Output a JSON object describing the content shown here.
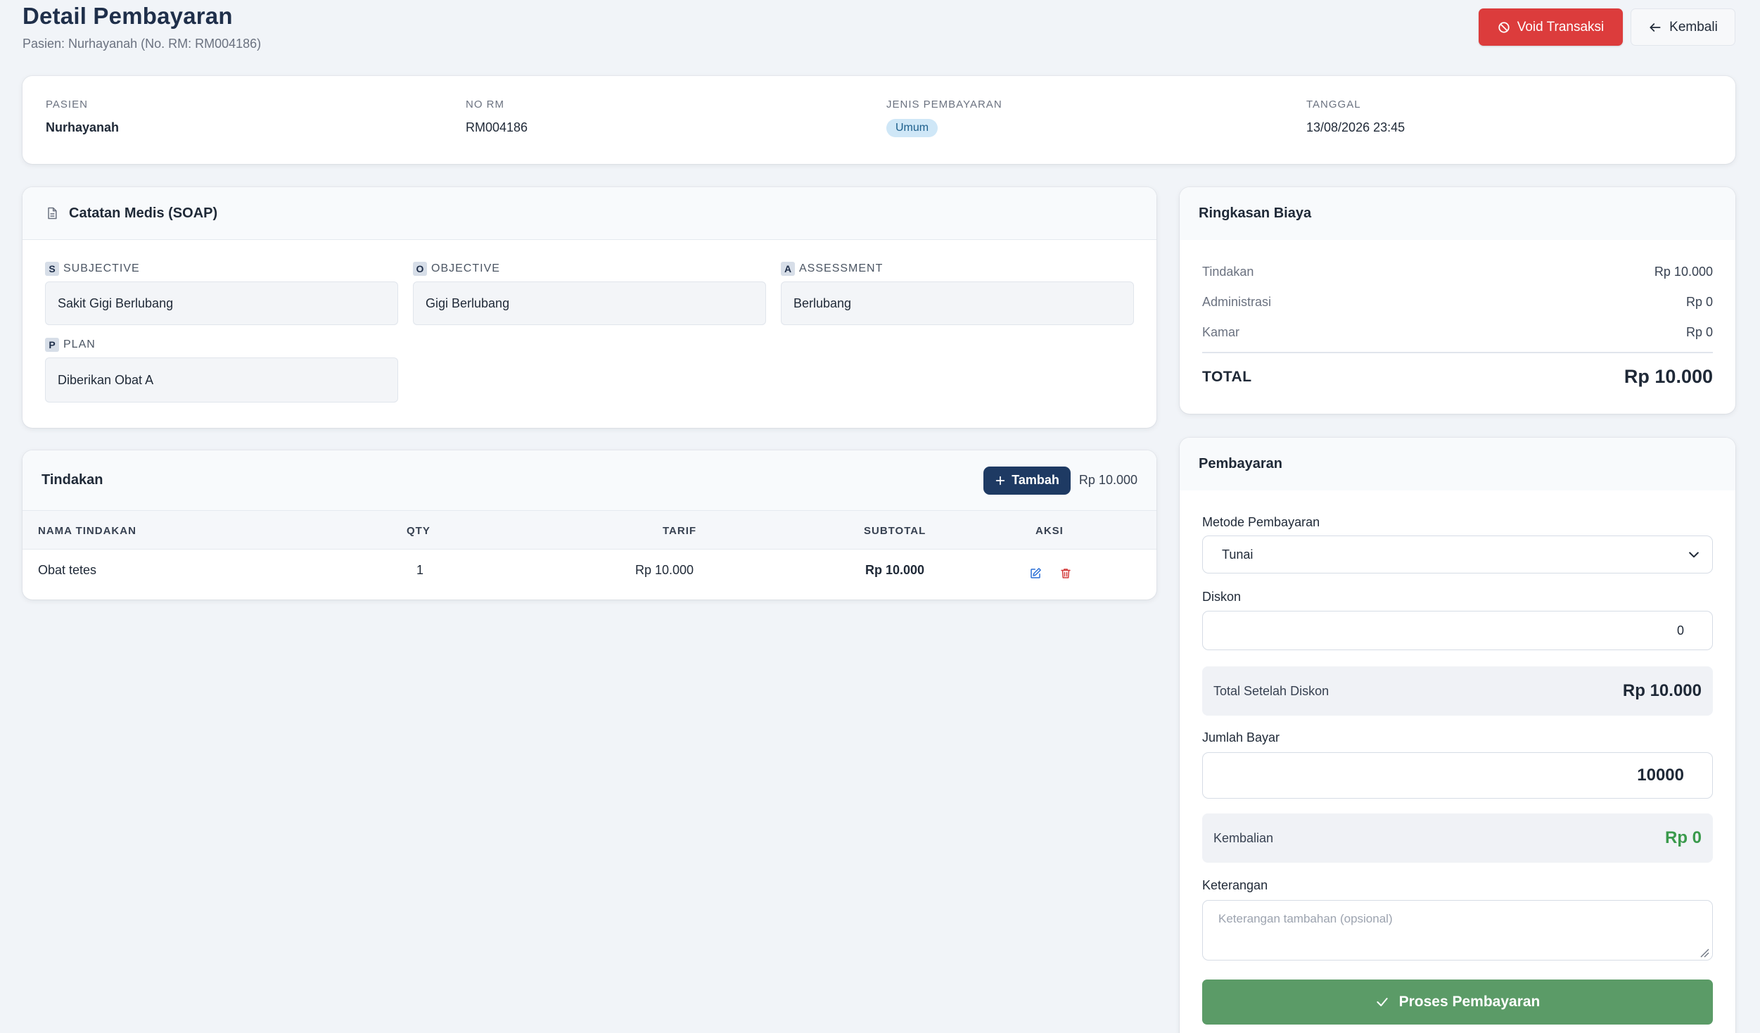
{
  "header": {
    "title": "Detail Pembayaran",
    "subtitle": "Pasien: Nurhayanah (No. RM: RM004186)",
    "void_label": "Void Transaksi",
    "back_label": "Kembali"
  },
  "info": {
    "pasien_label": "PASIEN",
    "pasien_value": "Nurhayanah",
    "norm_label": "NO RM",
    "norm_value": "RM004186",
    "jenis_label": "JENIS PEMBAYARAN",
    "jenis_value": "Umum",
    "tanggal_label": "TANGGAL",
    "tanggal_value": "13/08/2026 23:45"
  },
  "soap": {
    "title": "Catatan Medis (SOAP)",
    "subjective": {
      "letter": "S",
      "label": "SUBJECTIVE",
      "value": "Sakit Gigi Berlubang"
    },
    "objective": {
      "letter": "O",
      "label": "OBJECTIVE",
      "value": "Gigi Berlubang"
    },
    "assessment": {
      "letter": "A",
      "label": "ASSESSMENT",
      "value": "Berlubang"
    },
    "plan": {
      "letter": "P",
      "label": "PLAN",
      "value": "Diberikan Obat A"
    }
  },
  "tindakan": {
    "title": "Tindakan",
    "add_label": "Tambah",
    "total": "Rp 10.000",
    "columns": [
      "NAMA TINDAKAN",
      "QTY",
      "TARIF",
      "SUBTOTAL",
      "AKSI"
    ],
    "rows": [
      {
        "nama": "Obat tetes",
        "qty": "1",
        "tarif": "Rp 10.000",
        "subtotal": "Rp 10.000"
      }
    ]
  },
  "ringkasan": {
    "title": "Ringkasan Biaya",
    "items": [
      {
        "label": "Tindakan",
        "value": "Rp 10.000"
      },
      {
        "label": "Administrasi",
        "value": "Rp 0"
      },
      {
        "label": "Kamar",
        "value": "Rp 0"
      }
    ],
    "total_label": "TOTAL",
    "total_value": "Rp 10.000"
  },
  "pembayaran": {
    "title": "Pembayaran",
    "metode_label": "Metode Pembayaran",
    "metode_value": "Tunai",
    "diskon_label": "Diskon",
    "diskon_value": "0",
    "total_setelah_label": "Total Setelah Diskon",
    "total_setelah_value": "Rp 10.000",
    "jumlah_label": "Jumlah Bayar",
    "jumlah_value": "10000",
    "kembalian_label": "Kembalian",
    "kembalian_value": "Rp 0",
    "keterangan_label": "Keterangan",
    "keterangan_placeholder": "Keterangan tambahan (opsional)",
    "submit_label": "Proses Pembayaran"
  },
  "colors": {
    "void": "#dc3c3c",
    "primary_navy": "#1e3a63",
    "success": "#5b9b67",
    "kembalian_green": "#3a9a4c"
  },
  "icons": {
    "void": "ban-icon",
    "back": "arrow-left-icon",
    "soap": "document-icon",
    "add": "plus-icon",
    "edit": "edit-icon",
    "delete": "trash-icon",
    "select": "chevron-down-icon",
    "submit": "check-icon"
  }
}
